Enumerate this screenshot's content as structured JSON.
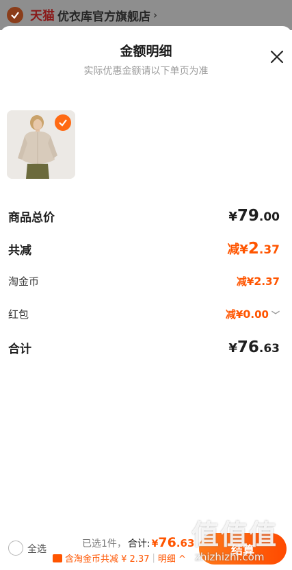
{
  "backdrop": {
    "brand": "天猫",
    "shop_name": "优衣库官方旗舰店",
    "chevron": "›"
  },
  "sheet": {
    "title": "金额明细",
    "subtitle": "实际优惠金额请以下单页为准",
    "close_icon": "close-icon"
  },
  "product": {
    "thumbnail": "shirt-product-thumbnail",
    "selected": true
  },
  "rows": {
    "subtotal": {
      "label": "商品总价",
      "yen": "¥",
      "int": "79",
      "dec": ".00"
    },
    "discount_total": {
      "label": "共减",
      "prefix": "减",
      "yen": "¥",
      "int": "2",
      "dec": ".37"
    },
    "taojinbi": {
      "label": "淘金币",
      "prefix": "减",
      "yen": "¥",
      "int": "2",
      "dec": ".37"
    },
    "red_packet": {
      "label": "红包",
      "prefix": "减",
      "yen": "¥",
      "int": "0",
      "dec": ".00",
      "chevron": "﹀"
    },
    "total": {
      "label": "合计",
      "yen": "¥",
      "int": "76",
      "dec": ".63"
    }
  },
  "bottom": {
    "select_all": "全选",
    "selected_count": "已选1件，",
    "total_label": "合计:",
    "yen": "¥",
    "int": "76",
    "dec": ".63",
    "coin_text": "含淘金币共减 ¥ 2.37",
    "separator": "|",
    "detail_link": "明细 ^",
    "checkout_label": "结算"
  },
  "watermark": {
    "text": "值值值",
    "url": "zhizhizhi.com"
  },
  "colors": {
    "accent": "#ff5500",
    "checkout_gradient_start": "#ff7a1a",
    "checkout_gradient_end": "#ff4a00",
    "backdrop": "#8e8e8e"
  }
}
